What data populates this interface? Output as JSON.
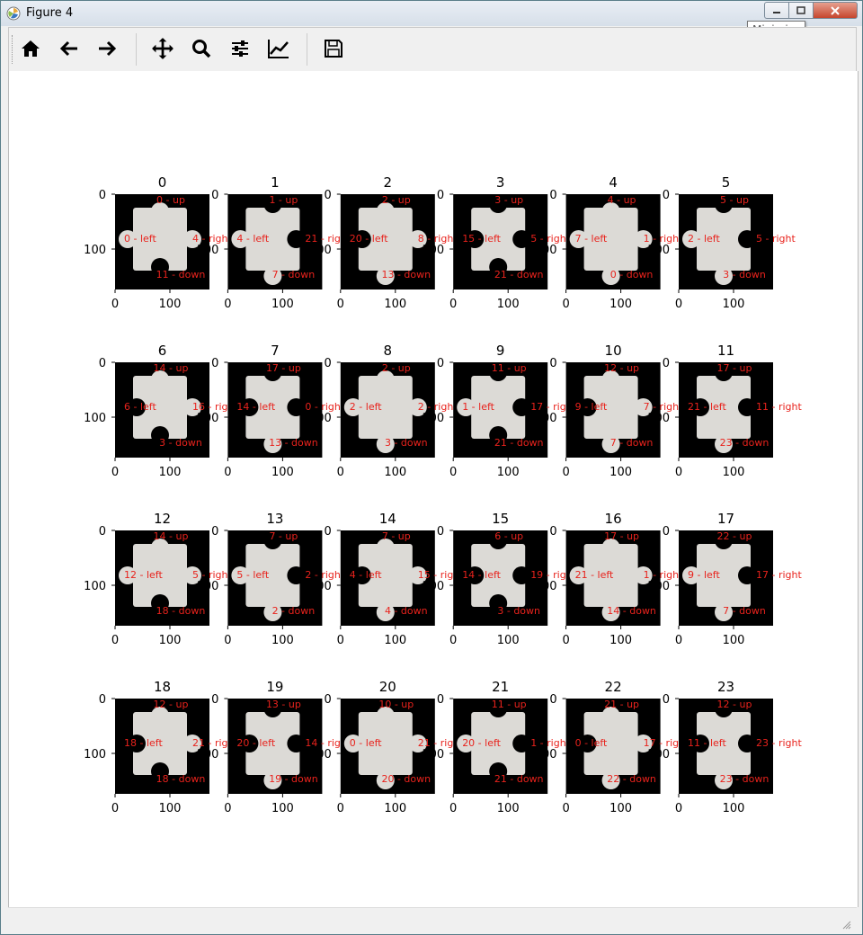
{
  "window": {
    "title": "Figure 4",
    "tooltip": "Minimize"
  },
  "toolbar": [
    {
      "name": "home",
      "icon": "home-icon"
    },
    {
      "name": "back",
      "icon": "arrow-left-icon"
    },
    {
      "name": "forward",
      "icon": "arrow-right-icon"
    },
    {
      "name": "pan",
      "icon": "move-icon"
    },
    {
      "name": "zoom",
      "icon": "zoom-icon"
    },
    {
      "name": "configure-subplots",
      "icon": "sliders-icon"
    },
    {
      "name": "edit-axes",
      "icon": "line-chart-icon"
    },
    {
      "name": "save",
      "icon": "save-icon"
    }
  ],
  "axes": {
    "x_ticks": [
      "0",
      "100"
    ],
    "y_ticks": [
      "0",
      "100"
    ],
    "label_color": "#e8221c"
  },
  "pieces": [
    {
      "title": "0",
      "up": "0 - up",
      "left": "0 - left",
      "right": "4 - righ",
      "down": "11 - down"
    },
    {
      "title": "1",
      "up": "1 - up",
      "left": "4 - left",
      "right": "21 - rig",
      "down": "7 - down"
    },
    {
      "title": "2",
      "up": "2 - up",
      "left": "20 - left",
      "right": "8 - righ",
      "down": "13 - down"
    },
    {
      "title": "3",
      "up": "3 - up",
      "left": "15 - left",
      "right": "5 - righ",
      "down": "21 - down"
    },
    {
      "title": "4",
      "up": "4 - up",
      "left": "7 - left",
      "right": "1 - righ",
      "down": "0 - down"
    },
    {
      "title": "5",
      "up": "5 - up",
      "left": "2 - left",
      "right": "5 - right",
      "down": "3 - down"
    },
    {
      "title": "6",
      "up": "14 - up",
      "left": "6 - left",
      "right": "16 - righ",
      "down": "3 - down"
    },
    {
      "title": "7",
      "up": "17 - up",
      "left": "14 - left",
      "right": "0 - righ",
      "down": "13 - down"
    },
    {
      "title": "8",
      "up": "2 - up",
      "left": "2 - left",
      "right": "2 - righ",
      "down": "3 - down"
    },
    {
      "title": "9",
      "up": "11 - up",
      "left": "1 - left",
      "right": "17 - righ",
      "down": "21 - down"
    },
    {
      "title": "10",
      "up": "12 - up",
      "left": "9 - left",
      "right": "7 - righ",
      "down": "7 - down"
    },
    {
      "title": "11",
      "up": "17 - up",
      "left": "21 - left",
      "right": "11 - right",
      "down": "23 - down"
    },
    {
      "title": "12",
      "up": "14 - up",
      "left": "12 - left",
      "right": "5 - righ",
      "down": "18 - down"
    },
    {
      "title": "13",
      "up": "7 - up",
      "left": "5 - left",
      "right": "2 - righ",
      "down": "2 - down"
    },
    {
      "title": "14",
      "up": "7 - up",
      "left": "4 - left",
      "right": "15 - righ",
      "down": "4 - down"
    },
    {
      "title": "15",
      "up": "6 - up",
      "left": "14 - left",
      "right": "19 - rig",
      "down": "3 - down"
    },
    {
      "title": "16",
      "up": "17 - up",
      "left": "21 - left",
      "right": "1 - righ",
      "down": "14 - down"
    },
    {
      "title": "17",
      "up": "22 - up",
      "left": "9 - left",
      "right": "17 - right",
      "down": "7 - down"
    },
    {
      "title": "18",
      "up": "12 - up",
      "left": "18 - left",
      "right": "21 - rig",
      "down": "18 - down"
    },
    {
      "title": "19",
      "up": "13 - up",
      "left": "20 - left",
      "right": "14 - rig",
      "down": "19 - down"
    },
    {
      "title": "20",
      "up": "10 - up",
      "left": "0 - left",
      "right": "21 - rig",
      "down": "20 - down"
    },
    {
      "title": "21",
      "up": "11 - up",
      "left": "20 - left",
      "right": "1 - righ",
      "down": "21 - down"
    },
    {
      "title": "22",
      "up": "21 - up",
      "left": "0 - left",
      "right": "17 - rig",
      "down": "22 - down"
    },
    {
      "title": "23",
      "up": "12 - up",
      "left": "11 - left",
      "right": "23 - right",
      "down": "23 - down"
    }
  ]
}
